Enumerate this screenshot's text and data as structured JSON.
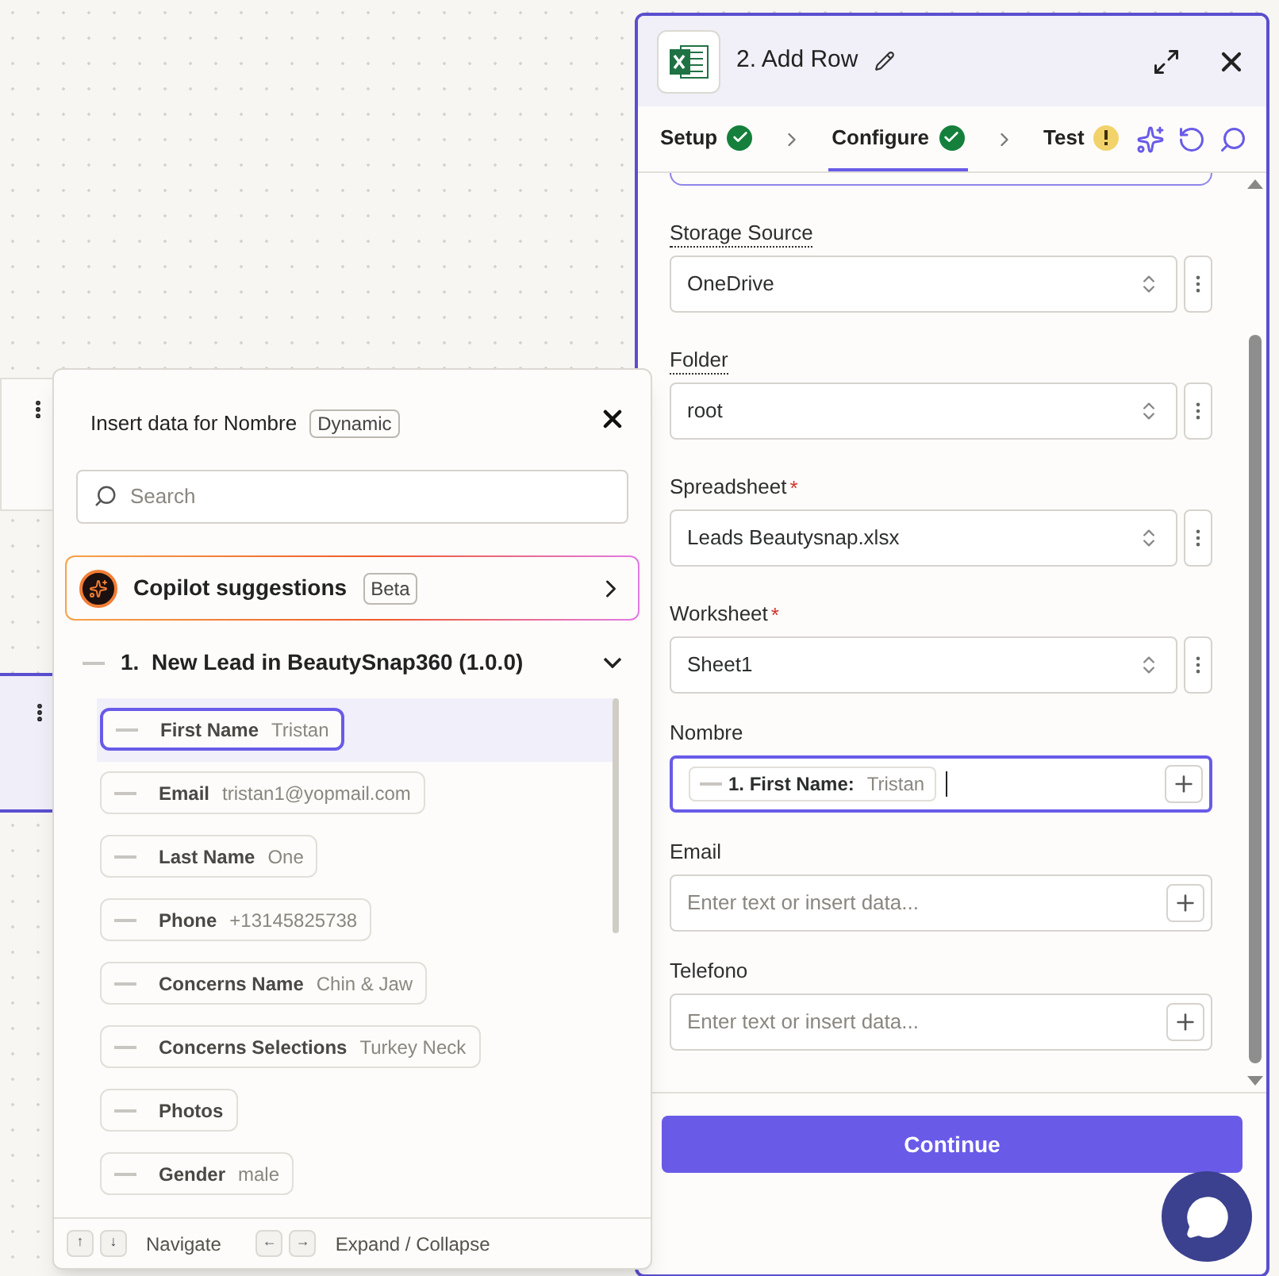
{
  "panel": {
    "title": "2. Add Row",
    "steps": [
      {
        "label": "Setup",
        "complete": true,
        "selected": false
      },
      {
        "label": "Configure",
        "complete": true,
        "selected": true
      },
      {
        "label": "Test",
        "complete": false,
        "selected": false
      }
    ],
    "fields": [
      {
        "kind": "select",
        "label": "Storage Source",
        "hint": true,
        "value": "OneDrive"
      },
      {
        "kind": "select",
        "label": "Folder",
        "hint": true,
        "value": "root"
      },
      {
        "kind": "select",
        "label": "Spreadsheet",
        "hint": false,
        "required_mark": "*",
        "value": "Leads Beautysnap.xlsx"
      },
      {
        "kind": "select",
        "label": "Worksheet",
        "hint": false,
        "required_mark": "*",
        "value": "Sheet1"
      },
      {
        "kind": "text",
        "label": "Nombre",
        "focused": true,
        "token": {
          "field": "1. First Name:",
          "value": "Tristan"
        }
      },
      {
        "kind": "text",
        "label": "Email",
        "focused": false,
        "placeholder": "Enter text or insert data..."
      },
      {
        "kind": "text",
        "label": "Telefono",
        "focused": false,
        "placeholder": "Enter text or insert data..."
      }
    ],
    "button": "Continue"
  },
  "popup": {
    "title": "Insert data for Nombre",
    "badge": "Dynamic",
    "search": {
      "placeholder": "Search"
    },
    "copilot": {
      "label": "Copilot suggestions",
      "badge": "Beta"
    },
    "group": {
      "title": "1.  New Lead in BeautySnap360 (1.0.0)",
      "expanded": true
    },
    "items": [
      {
        "label": "First Name",
        "value": "Tristan",
        "selected": true
      },
      {
        "label": "Email",
        "value": "tristan1@yopmail.com",
        "selected": false
      },
      {
        "label": "Last Name",
        "value": "One",
        "selected": false
      },
      {
        "label": "Phone",
        "value": "+13145825738",
        "selected": false
      },
      {
        "label": "Concerns Name",
        "value": "Chin & Jaw",
        "selected": false
      },
      {
        "label": "Concerns Selections",
        "value": "Turkey Neck",
        "selected": false
      },
      {
        "label": "Photos",
        "selected": false
      },
      {
        "label": "Gender",
        "value": "male",
        "selected": false
      }
    ],
    "hints": [
      {
        "keys": [
          "↑",
          "↓"
        ],
        "label": "Navigate"
      },
      {
        "keys": [
          "←",
          "→"
        ],
        "label": "Expand / Collapse"
      }
    ]
  }
}
